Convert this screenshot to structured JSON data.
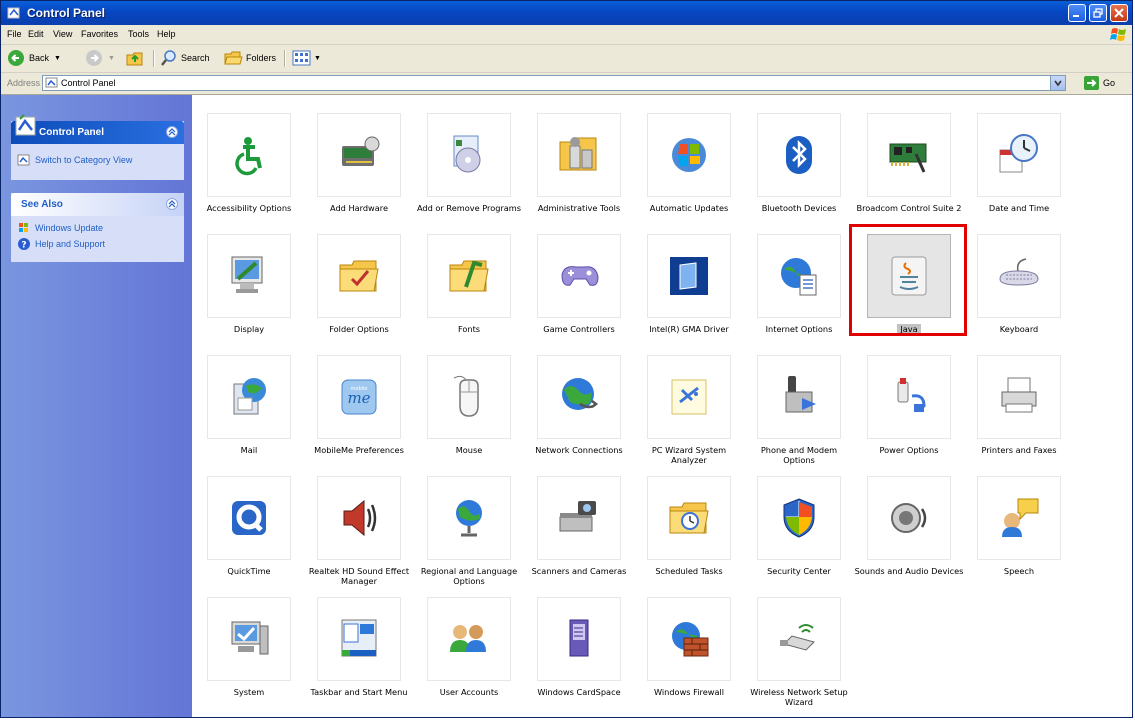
{
  "window": {
    "title": "Control Panel"
  },
  "menu": [
    "File",
    "Edit",
    "View",
    "Favorites",
    "Tools",
    "Help"
  ],
  "toolbar": {
    "back": "Back",
    "search": "Search",
    "folders": "Folders"
  },
  "address": {
    "label": "Address",
    "value": "Control Panel",
    "go": "Go"
  },
  "sidebar": {
    "panel_title": "Control Panel",
    "switch_view": "Switch to Category View",
    "see_also_title": "See Also",
    "see_also": [
      "Windows Update",
      "Help and Support"
    ]
  },
  "items": [
    {
      "label": "Accessibility Options",
      "icon": "accessibility-icon"
    },
    {
      "label": "Add Hardware",
      "icon": "add-hardware-icon"
    },
    {
      "label": "Add or Remove Programs",
      "icon": "add-remove-programs-icon"
    },
    {
      "label": "Administrative Tools",
      "icon": "administrative-tools-icon"
    },
    {
      "label": "Automatic Updates",
      "icon": "automatic-updates-icon"
    },
    {
      "label": "Bluetooth Devices",
      "icon": "bluetooth-icon"
    },
    {
      "label": "Broadcom Control Suite 2",
      "icon": "network-card-icon"
    },
    {
      "label": "Date and Time",
      "icon": "clock-calendar-icon"
    },
    {
      "label": "Display",
      "icon": "display-icon"
    },
    {
      "label": "Folder Options",
      "icon": "folder-options-icon"
    },
    {
      "label": "Fonts",
      "icon": "fonts-folder-icon"
    },
    {
      "label": "Game Controllers",
      "icon": "gamepad-icon"
    },
    {
      "label": "Intel(R) GMA Driver",
      "icon": "intel-gma-icon"
    },
    {
      "label": "Internet Options",
      "icon": "globe-document-icon"
    },
    {
      "label": "Java",
      "icon": "java-cup-icon",
      "selected": true
    },
    {
      "label": "Keyboard",
      "icon": "keyboard-icon"
    },
    {
      "label": "Mail",
      "icon": "mail-icon"
    },
    {
      "label": "MobileMe Preferences",
      "icon": "mobileme-icon"
    },
    {
      "label": "Mouse",
      "icon": "mouse-icon"
    },
    {
      "label": "Network Connections",
      "icon": "network-globe-icon"
    },
    {
      "label": "PC Wizard System Analyzer",
      "icon": "pc-wizard-icon"
    },
    {
      "label": "Phone and Modem Options",
      "icon": "phone-modem-icon"
    },
    {
      "label": "Power Options",
      "icon": "power-plug-icon"
    },
    {
      "label": "Printers and Faxes",
      "icon": "printer-icon"
    },
    {
      "label": "QuickTime",
      "icon": "quicktime-icon"
    },
    {
      "label": "Realtek HD Sound Effect Manager",
      "icon": "speaker-icon"
    },
    {
      "label": "Regional and Language Options",
      "icon": "globe-stand-icon"
    },
    {
      "label": "Scanners and Cameras",
      "icon": "scanner-camera-icon"
    },
    {
      "label": "Scheduled Tasks",
      "icon": "scheduled-tasks-icon"
    },
    {
      "label": "Security Center",
      "icon": "shield-icon"
    },
    {
      "label": "Sounds and Audio Devices",
      "icon": "audio-speaker-icon"
    },
    {
      "label": "Speech",
      "icon": "speech-icon"
    },
    {
      "label": "System",
      "icon": "system-computer-icon"
    },
    {
      "label": "Taskbar and Start Menu",
      "icon": "taskbar-icon"
    },
    {
      "label": "User Accounts",
      "icon": "user-accounts-icon"
    },
    {
      "label": "Windows CardSpace",
      "icon": "cardspace-icon"
    },
    {
      "label": "Windows Firewall",
      "icon": "firewall-icon"
    },
    {
      "label": "Wireless Network Setup Wizard",
      "icon": "wireless-usb-icon"
    }
  ]
}
